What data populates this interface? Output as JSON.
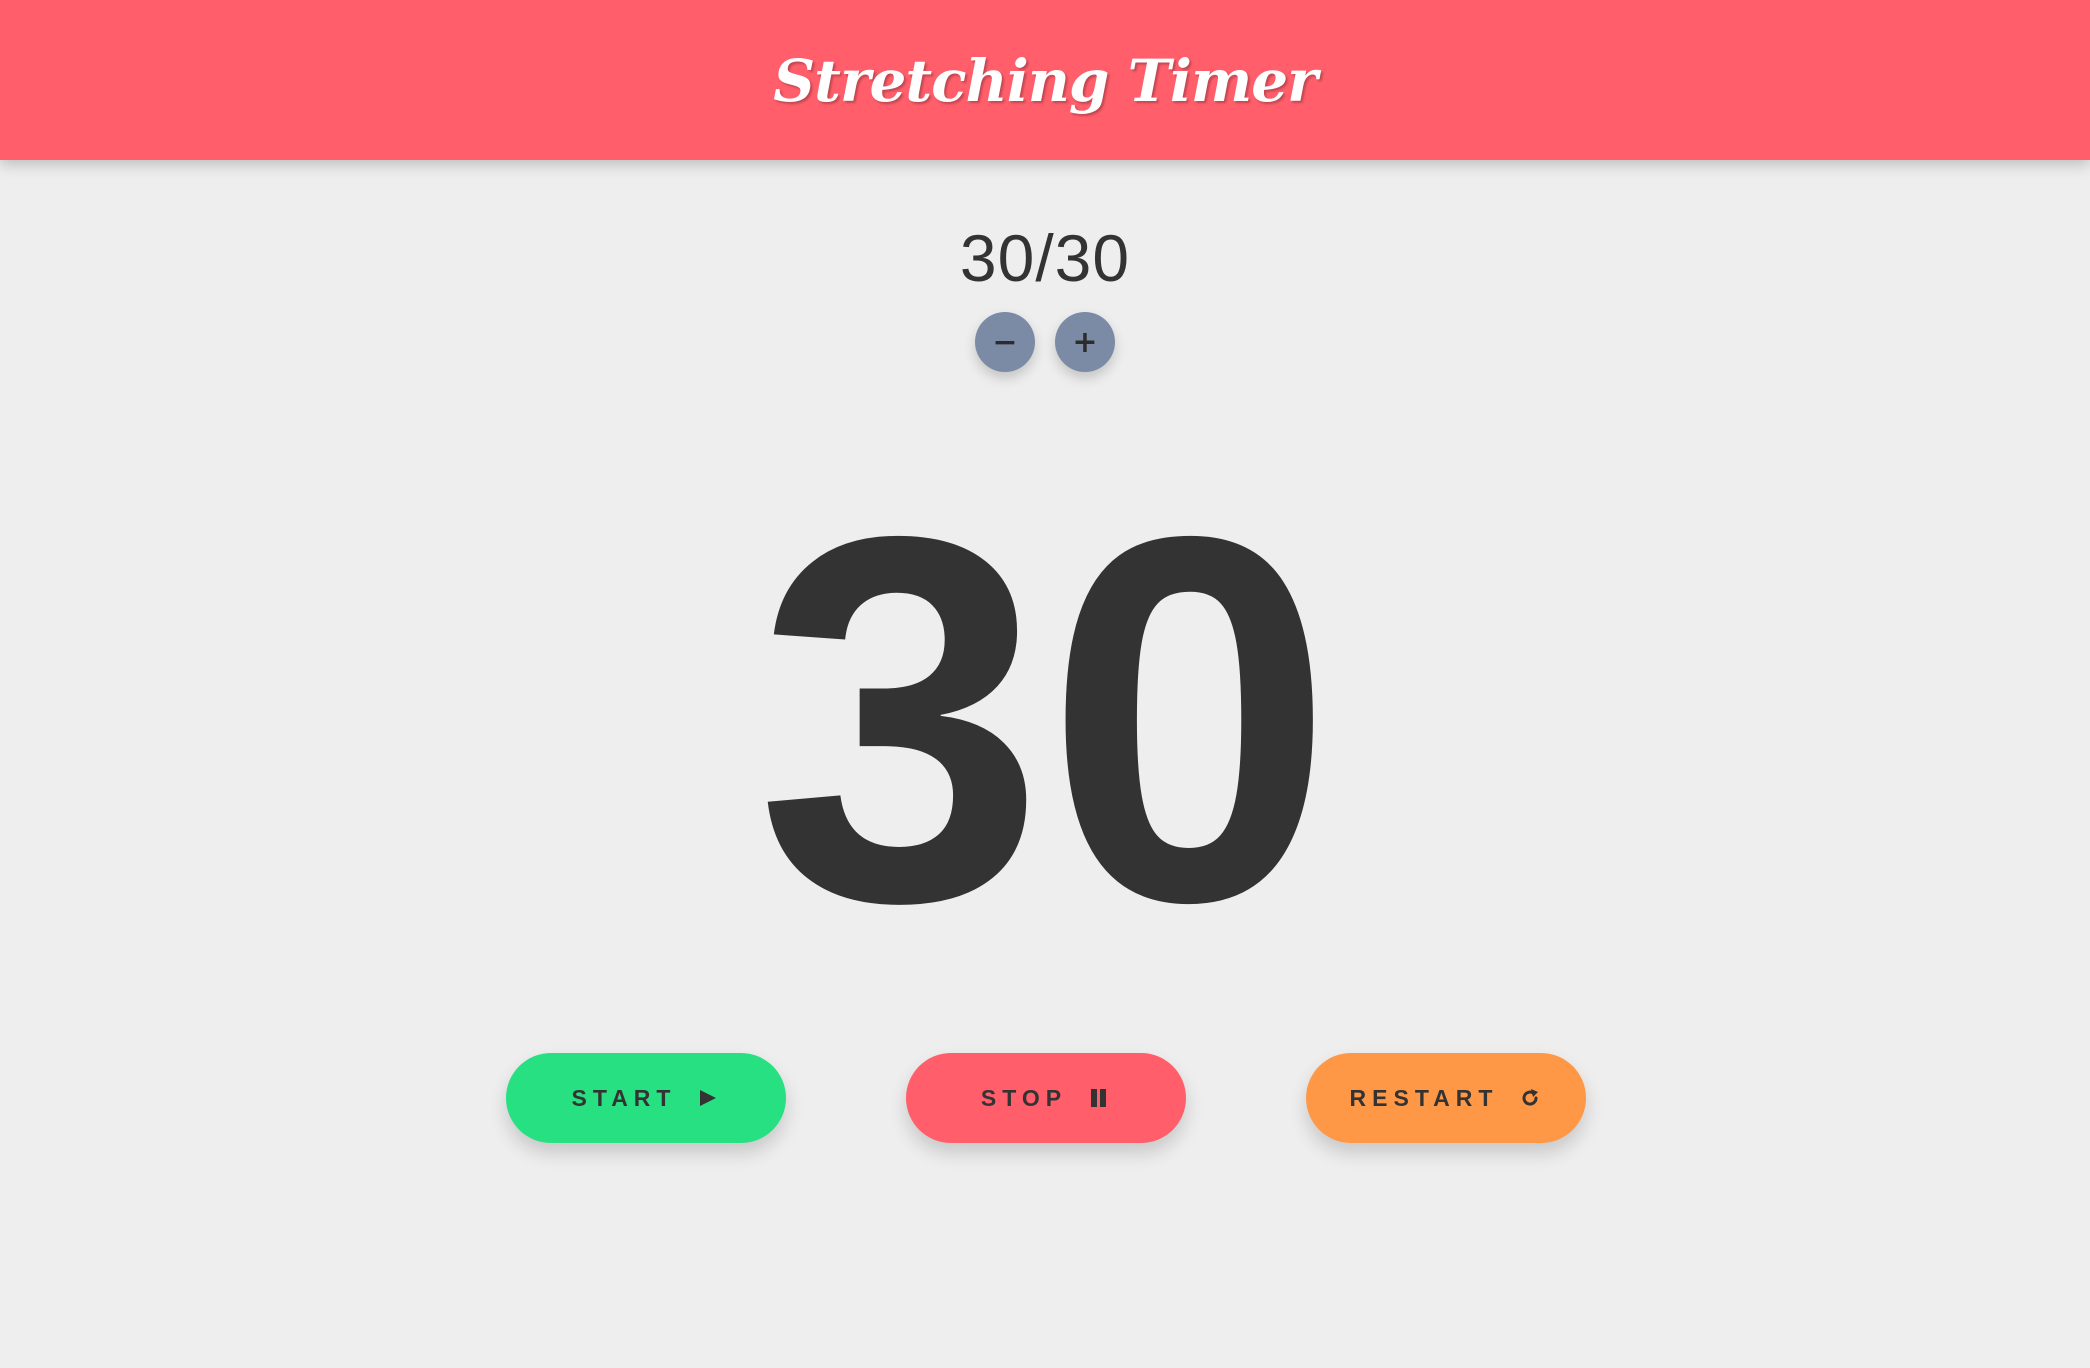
{
  "header": {
    "title": "Stretching Timer",
    "background": "#ff5e6a"
  },
  "rounds": {
    "text": "30/30",
    "decrement_label": "−",
    "increment_label": "+"
  },
  "timer": {
    "value": "30"
  },
  "actions": {
    "start": {
      "label": "START",
      "icon": "play-icon",
      "color": "#27e081"
    },
    "stop": {
      "label": "STOP",
      "icon": "pause-icon",
      "color": "#ff5e6a"
    },
    "restart": {
      "label": "RESTART",
      "icon": "restart-icon",
      "color": "#ff9846"
    }
  },
  "colors": {
    "page_background": "#eeeeee",
    "text": "#333333",
    "round_button": "#7b8ba5"
  }
}
